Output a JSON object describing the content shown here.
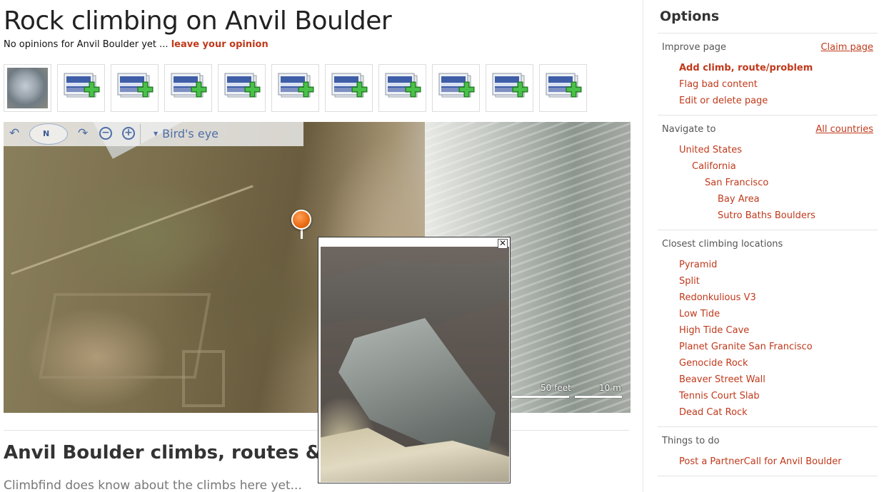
{
  "page": {
    "title": "Rock climbing on Anvil Boulder",
    "opinions_prefix": "No opinions for Anvil Boulder yet ...",
    "opinions_link": "leave your opinion",
    "section_title": "Anvil Boulder climbs, routes & prob",
    "notice": "Climbfind does know about the climbs here yet..."
  },
  "thumbnails": {
    "photo_icon": "boulder-photo-thumbnail",
    "add_icon": "add-image-icon",
    "add_count": 10
  },
  "map": {
    "compass_label": "N",
    "view_label": "Bird's eye",
    "scale_feet": "50 feet",
    "scale_meters": "10 m",
    "close_label": "✕"
  },
  "sidebar": {
    "title": "Options",
    "improve": {
      "heading": "Improve page",
      "right_link": "Claim page",
      "links": [
        "Add climb, route/problem",
        "Flag bad content",
        "Edit or delete page"
      ]
    },
    "navigate": {
      "heading": "Navigate to",
      "right_link": "All countries",
      "links": [
        "United States",
        "California",
        "San Francisco",
        "Bay Area",
        "Sutro Baths Boulders"
      ]
    },
    "closest": {
      "heading": "Closest climbing locations",
      "links": [
        "Pyramid",
        "Split",
        "Redonkulious V3",
        "Low Tide",
        "High Tide Cave",
        "Planet Granite San Francisco",
        "Genocide Rock",
        "Beaver Street Wall",
        "Tennis Court Slab",
        "Dead Cat Rock"
      ]
    },
    "todo": {
      "heading": "Things to do",
      "links": [
        "Post a PartnerCall for Anvil Boulder"
      ]
    }
  },
  "colors": {
    "link": "#c0391b",
    "pin": "#ea6a12",
    "map_control": "#4f6fa8"
  }
}
